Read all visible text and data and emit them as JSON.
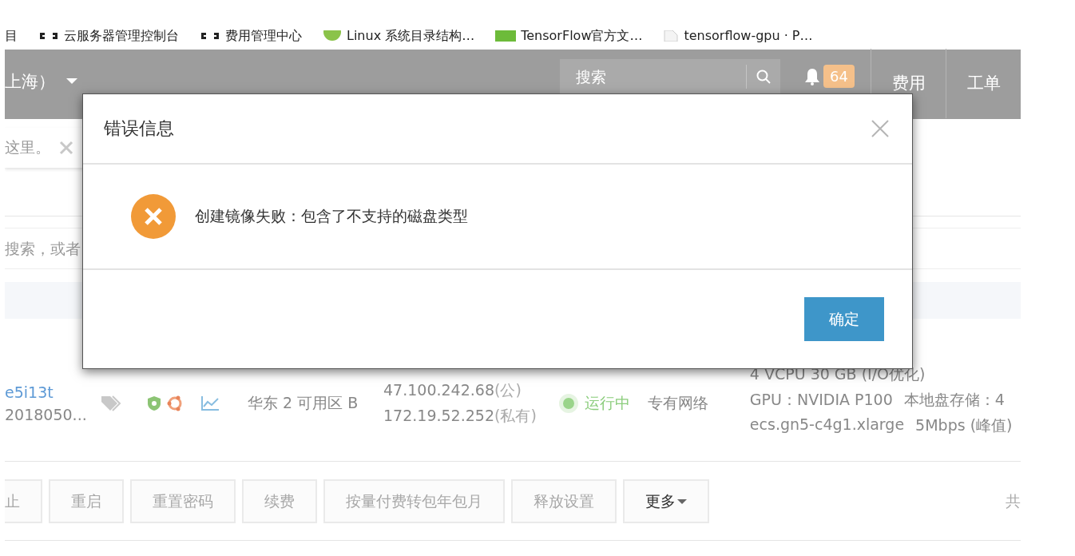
{
  "bookmarks": [
    {
      "kind": "plain",
      "label": "目"
    },
    {
      "kind": "cloud",
      "label": "云服务器管理控制台"
    },
    {
      "kind": "cloud",
      "label": "费用管理中心"
    },
    {
      "kind": "round",
      "label": "Linux 系统目录结构…"
    },
    {
      "kind": "square",
      "label": "TensorFlow官方文…"
    },
    {
      "kind": "page",
      "label": "tensorflow-gpu · P…"
    }
  ],
  "header": {
    "region": "上海）",
    "search": {
      "placeholder": "搜索"
    },
    "notifications": "64",
    "links": [
      "费用",
      "工单"
    ]
  },
  "notice": {
    "text": "这里。"
  },
  "search": {
    "placeholder": "搜索，或者"
  },
  "instance": {
    "name": "e5i13t",
    "id": "2018050...",
    "zone": "华东 2 可用区 B",
    "ips": [
      {
        "address": "47.100.242.68",
        "type": "(公)"
      },
      {
        "address": "172.19.52.252",
        "type": "(私有)"
      }
    ],
    "status": {
      "label": "运行中"
    },
    "network": "专有网络",
    "spec_lines": [
      [
        "4 VCPU 30 GB (I/O优化)"
      ],
      [
        "GPU：NVIDIA P100",
        "本地盘存储：4"
      ],
      [
        "ecs.gn5-c4g1.xlarge",
        "5Mbps (峰值)"
      ]
    ]
  },
  "actions": [
    {
      "label": "止",
      "disabled": true,
      "kind": "plain"
    },
    {
      "label": "重启",
      "disabled": true,
      "kind": "plain"
    },
    {
      "label": "重置密码",
      "disabled": true,
      "kind": "plain"
    },
    {
      "label": "续费",
      "disabled": true,
      "kind": "plain"
    },
    {
      "label": "按量付费转包年包月",
      "disabled": true,
      "kind": "plain"
    },
    {
      "label": "释放设置",
      "disabled": true,
      "kind": "plain"
    },
    {
      "label": "更多",
      "disabled": false,
      "kind": "dropdown"
    }
  ],
  "pagination": "共",
  "dialog": {
    "title": "错误信息",
    "message": "创建镜像失败：包含了不支持的磁盘类型",
    "buttons": [
      "确定"
    ]
  }
}
